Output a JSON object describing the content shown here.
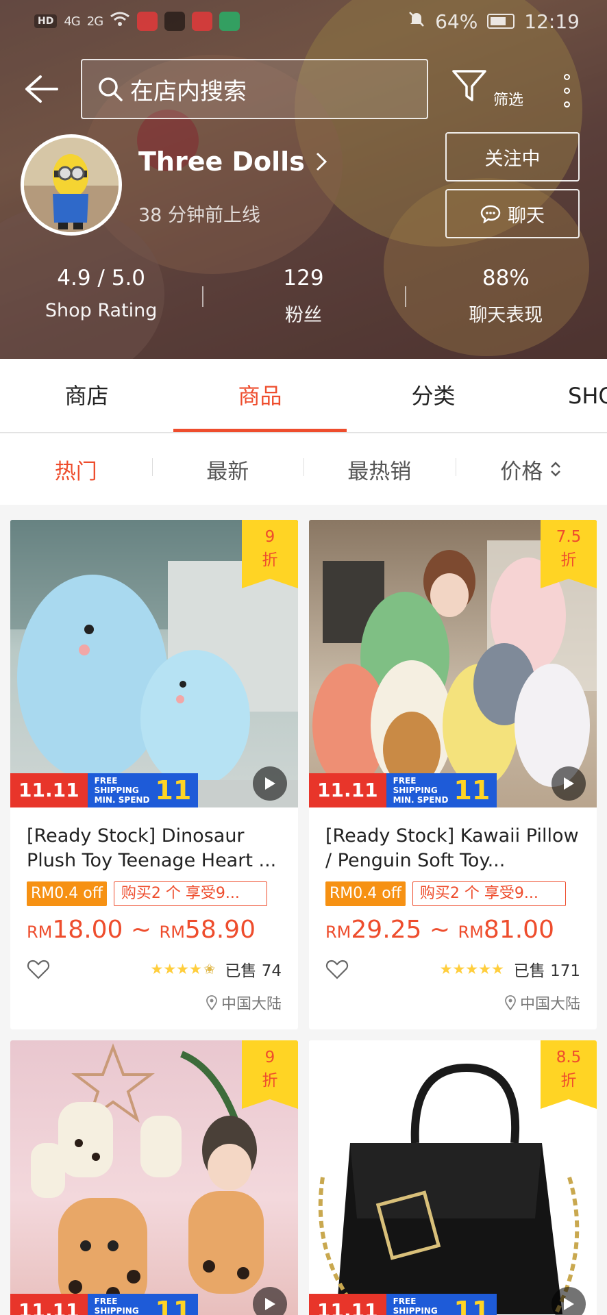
{
  "status_bar": {
    "network_chip": "HD",
    "signal_1": "4G",
    "signal_2": "2G",
    "battery": "64%",
    "time": "12:19"
  },
  "search": {
    "placeholder": "在店内搜索",
    "filter_label": "筛选"
  },
  "shop": {
    "name": "Three Dolls",
    "last_online": "38 分钟前上线",
    "follow_label": "关注中",
    "chat_label": "聊天",
    "stats": [
      {
        "value": "4.9 / 5.0",
        "label": "Shop Rating"
      },
      {
        "value": "129",
        "label": "粉丝"
      },
      {
        "value": "88%",
        "label": "聊天表现"
      }
    ]
  },
  "tabs": [
    "商店",
    "商品",
    "分类",
    "SHOCK"
  ],
  "active_tab": "商品",
  "sort": {
    "hot": "热门",
    "new": "最新",
    "best": "最热销",
    "price": "价格"
  },
  "promo": {
    "event": "11.11",
    "free_line1": "FREE",
    "free_line2": "SHIPPING",
    "free_line3": "MIN. SPEND",
    "free_num": "11"
  },
  "products": [
    {
      "title": "[Ready Stock] Dinosaur Plush Toy Teenage Heart ...",
      "discount_top": "9",
      "discount_bottom": "折",
      "coupon": "RM0.4 off",
      "bundle": "购买2 个 享受9...",
      "currency": "RM",
      "price_min": "18.00",
      "sep": "~",
      "price_max": "58.90",
      "rating": 4.5,
      "sold": "已售 74",
      "location": "中国大陆"
    },
    {
      "title": "[Ready Stock] Kawaii Pillow / Penguin Soft Toy...",
      "discount_top": "7.5",
      "discount_bottom": "折",
      "coupon": "RM0.4 off",
      "bundle": "购买2 个 享受9...",
      "currency": "RM",
      "price_min": "29.25",
      "sep": "~",
      "price_max": "81.00",
      "rating": 5,
      "sold": "已售 171",
      "location": "中国大陆"
    },
    {
      "discount_top": "9",
      "discount_bottom": "折"
    },
    {
      "discount_top": "8.5",
      "discount_bottom": "折"
    }
  ],
  "colors": {
    "accent": "#ee4d2d",
    "coupon": "#f69113",
    "discount_badge": "#ffd424",
    "star": "#ffce3d"
  }
}
